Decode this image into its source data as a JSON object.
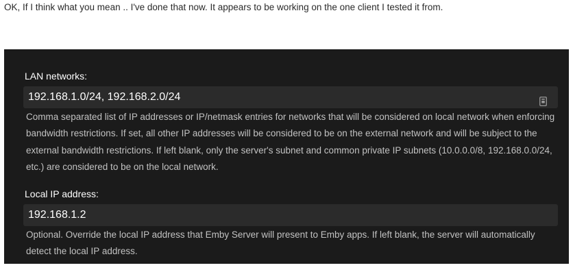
{
  "post": {
    "text": "OK, If I think what you mean .. I've done that now. It appears to be working on the one client I tested it from."
  },
  "settings": {
    "lan_networks": {
      "label": "LAN networks:",
      "value": "192.168.1.0/24, 192.168.2.0/24",
      "icon": "password-manager-icon",
      "help": "Comma separated list of IP addresses or IP/netmask entries for networks that will be considered on local network when enforcing bandwidth restrictions. If set, all other IP addresses will be considered to be on the external network and will be subject to the external bandwidth restrictions. If left blank, only the server's subnet and common private IP subnets (10.0.0.0/8, 192.168.0.0/24, etc.) are considered to be on the local network."
    },
    "local_ip": {
      "label": "Local IP address:",
      "value": "192.168.1.2",
      "help": "Optional. Override the local IP address that Emby Server will present to Emby apps. If left blank, the server will automatically detect the local IP address."
    }
  },
  "colors": {
    "panel_bg": "#1b1b1b",
    "input_bg": "#2b2b2b",
    "help_text": "#c2c2c2"
  }
}
